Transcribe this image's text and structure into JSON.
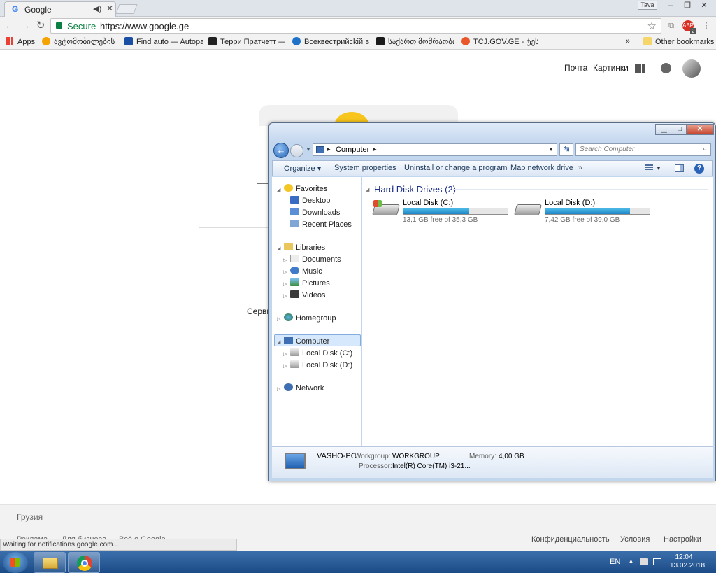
{
  "browser": {
    "tab_title": "Google",
    "tab_favicon": "G",
    "tab_audio_icon": "speaker-icon",
    "profile_label": "Tava",
    "window_controls": [
      "–",
      "❐",
      "✕"
    ],
    "secure_label": "Secure",
    "url": "https://www.google.ge",
    "ext_badge": "2",
    "bookmarks": [
      {
        "label": "Apps",
        "color": "#e94235"
      },
      {
        "label": "ავტომობილების ყიდ",
        "color": "#f4a300"
      },
      {
        "label": "Find auto — Autopar",
        "color": "#1a4fa3"
      },
      {
        "label": "Терри Пратчетт — Р",
        "color": "#222222"
      },
      {
        "label": "Всеквестрийсkій вЪс",
        "color": "#1e73c8"
      },
      {
        "label": "საქართ მომრაობის ყ",
        "color": "#1a1a1a"
      },
      {
        "label": "TCJ.GOV.GE - ტესტი",
        "color": "#e8562a"
      }
    ],
    "bookmarks_overflow": "»",
    "other_bookmarks": "Other bookmarks"
  },
  "google": {
    "links": [
      "Почта",
      "Картинки"
    ],
    "partial_text": "Серви",
    "region": "Грузия",
    "footer_left": [
      "Реклама",
      "Для бизнеса",
      "Всё о Google"
    ],
    "footer_right": [
      "Конфиденциальность",
      "Условия",
      "Настройки"
    ],
    "status": "Waiting for notifications.google.com..."
  },
  "explorer": {
    "breadcrumb": "Computer",
    "search_placeholder": "Search Computer",
    "commands": [
      "Organize ▾",
      "System properties",
      "Uninstall or change a program",
      "Map network drive",
      "»"
    ],
    "nav": {
      "favorites": "Favorites",
      "desktop": "Desktop",
      "downloads": "Downloads",
      "recent": "Recent Places",
      "libraries": "Libraries",
      "documents": "Documents",
      "music": "Music",
      "pictures": "Pictures",
      "videos": "Videos",
      "homegroup": "Homegroup",
      "computer": "Computer",
      "disk_c": "Local Disk (C:)",
      "disk_d": "Local Disk (D:)",
      "network": "Network"
    },
    "group_title": "Hard Disk Drives (2)",
    "drives": [
      {
        "name": "Local Disk (C:)",
        "free": "13,1 GB free of 35,3 GB",
        "used_fraction": 0.63
      },
      {
        "name": "Local Disk (D:)",
        "free": "7,42 GB free of 39,0 GB",
        "used_fraction": 0.81
      }
    ],
    "details": {
      "pc_name": "VASHO-PC",
      "workgroup_label": "Workgroup:",
      "workgroup": "WORKGROUP",
      "memory_label": "Memory:",
      "memory": "4,00 GB",
      "processor_label": "Processor:",
      "processor": "Intel(R) Core(TM) i3-21..."
    }
  },
  "taskbar": {
    "lang": "EN",
    "time": "12:04",
    "date": "13.02.2018"
  }
}
